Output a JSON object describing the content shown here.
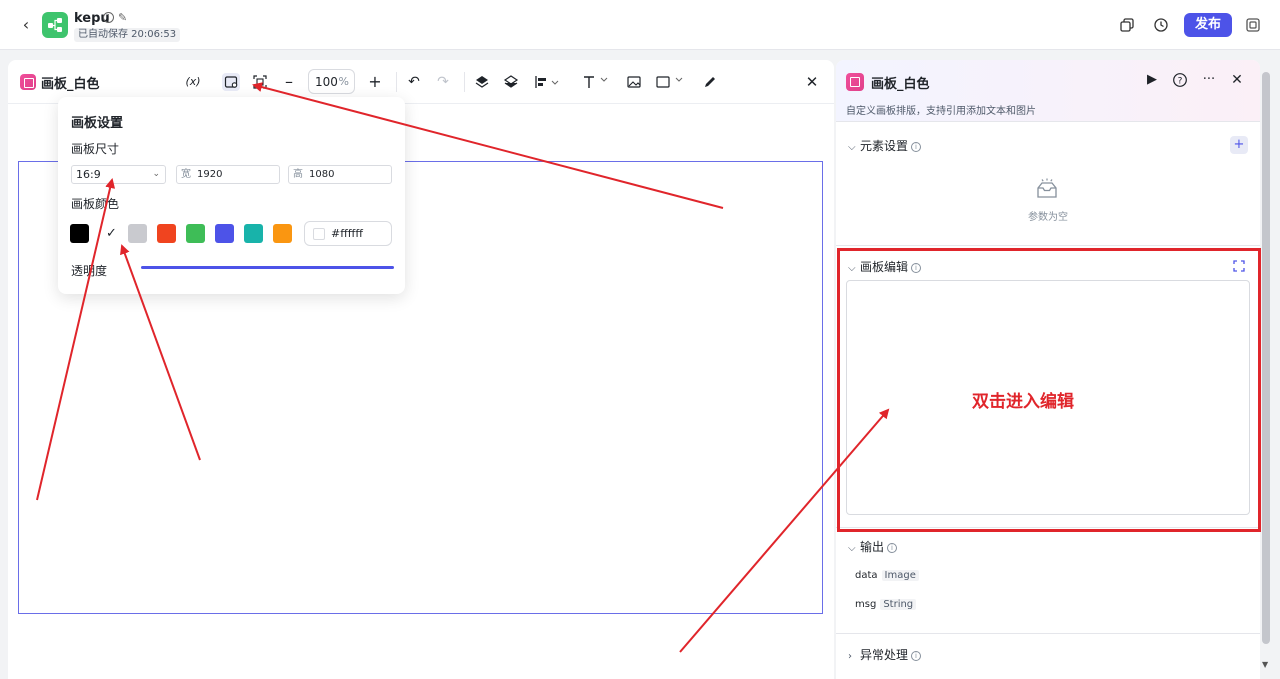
{
  "topbar": {
    "back_icon": "chevron-left-icon",
    "app_name": "kepu",
    "autosave": "已自动保存 20:06:53",
    "publish_label": "发布",
    "brand_color": "#4d53e8"
  },
  "canvas_panel": {
    "title": "画板_白色",
    "variable_label": "(x)",
    "zoom_value": "100",
    "zoom_unit": "%",
    "tools": [
      "variable-icon",
      "canvas-settings-icon",
      "fit-screen-icon",
      "zoom-out-icon",
      "zoom-in-icon",
      "undo-icon",
      "redo-icon",
      "layer-up-icon",
      "layers-icon",
      "align-icon",
      "text-icon",
      "image-icon",
      "shape-icon",
      "pen-icon",
      "close-icon"
    ]
  },
  "popover": {
    "title": "画板设置",
    "size_label": "画板尺寸",
    "ratio": "16:9",
    "width_prefix": "宽",
    "width": "1920",
    "height_prefix": "高",
    "height": "1080",
    "color_label": "画板颜色",
    "swatches": [
      "#000000",
      "#ffffff",
      "#c9cacf",
      "#f0441f",
      "#3ebd57",
      "#4d53e8",
      "#18b3aa",
      "#fa9611"
    ],
    "selected_swatch": "#ffffff",
    "hex_value": "#ffffff",
    "opacity_label": "透明度",
    "opacity": 1.0
  },
  "right_panel": {
    "title": "画板_白色",
    "description": "自定义画板排版，支持引用添加文本和图片",
    "elements_title": "元素设置",
    "empty_text": "参数为空",
    "canvas_edit_title": "画板编辑",
    "canvas_edit_annotation": "双击进入编辑",
    "output_title": "输出",
    "outputs": [
      {
        "name": "data",
        "type": "Image"
      },
      {
        "name": "msg",
        "type": "String"
      }
    ],
    "exception_title": "异常处理"
  },
  "annotation_color": "#e0252b"
}
